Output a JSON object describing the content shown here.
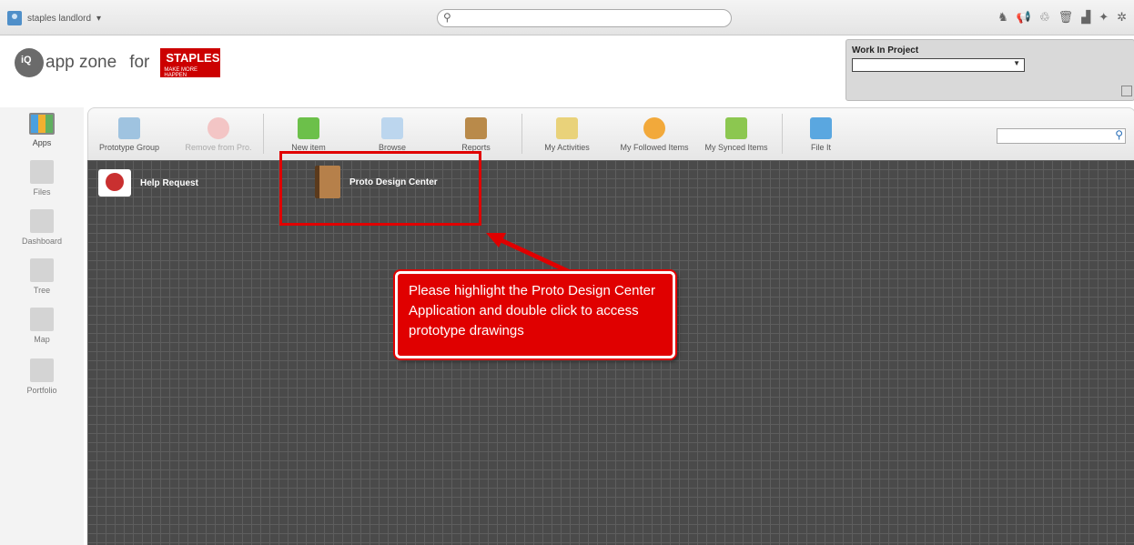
{
  "topbar": {
    "user_name": "staples landlord",
    "user_caret": "▾",
    "search_icon": "search-icon",
    "icons": [
      "user-icon",
      "megaphone-icon",
      "recycle-icon",
      "trash-icon",
      "chart-icon",
      "globe-icon",
      "settings-icon"
    ]
  },
  "header": {
    "logo_mark": "iQ",
    "app_zone": "app zone",
    "for": "for",
    "brand": "STAPLES",
    "brand_tagline": "MAKE MORE HAPPEN",
    "work_in_project_label": "Work In Project",
    "work_in_project_value": "",
    "select_caret": "▼"
  },
  "leftnav": {
    "items": [
      {
        "label": "Apps"
      },
      {
        "label": "Files"
      },
      {
        "label": "Dashboard"
      },
      {
        "label": "Tree"
      },
      {
        "label": "Map"
      },
      {
        "label": "Portfolio"
      }
    ]
  },
  "toolbar": {
    "buttons": [
      {
        "label": "Prototype Group"
      },
      {
        "label": "Remove from Pro."
      },
      {
        "label": "New item"
      },
      {
        "label": "Browse"
      },
      {
        "label": "Reports"
      },
      {
        "label": "My Activities"
      },
      {
        "label": "My Followed Items"
      },
      {
        "label": "My Synced Items"
      },
      {
        "label": "File It"
      }
    ],
    "search_value": ""
  },
  "apps": [
    {
      "label": "Help Request"
    },
    {
      "label": "Proto Design Center"
    }
  ],
  "callout": {
    "text": "Please highlight the Proto Design Center Application and double click to access prototype drawings"
  },
  "colors": {
    "brand_red": "#cc0000",
    "annotation_red": "#e00000",
    "grid_bg": "#4a4a4a"
  }
}
